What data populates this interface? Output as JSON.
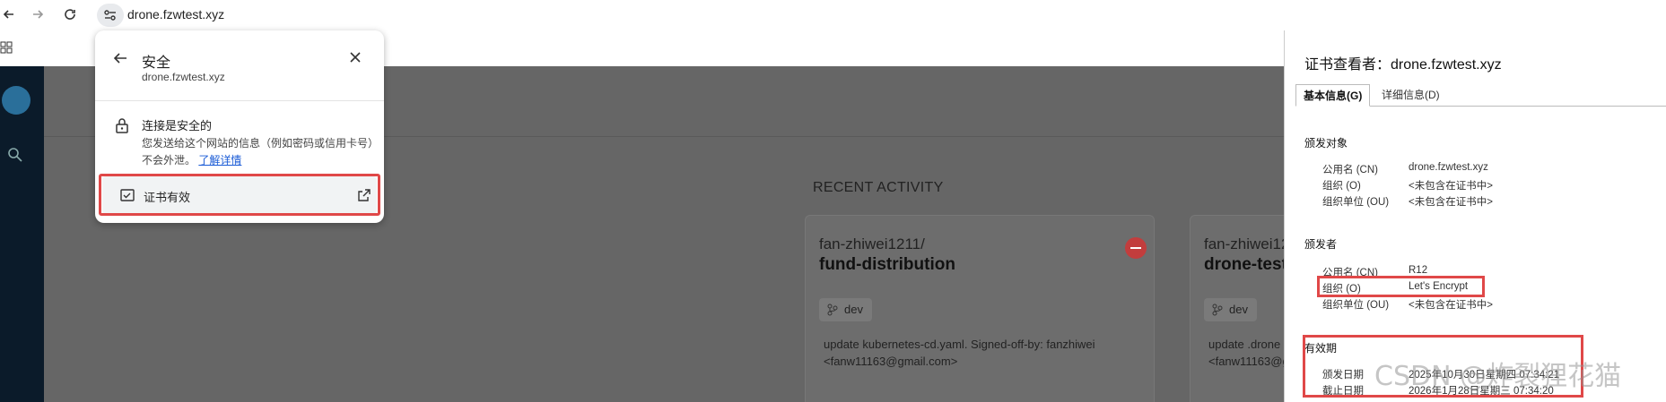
{
  "browser": {
    "url": "drone.fzwtest.xyz"
  },
  "security_popup": {
    "title": "安全",
    "domain": "drone.fzwtest.xyz",
    "connection_title": "连接是安全的",
    "connection_desc": "您发送给这个网站的信息（例如密码或信用卡号）不会外泄。",
    "learn_more": "了解详情",
    "cert_label": "证书有效"
  },
  "drone": {
    "recent_activity": "RECENT ACTIVITY",
    "cards": [
      {
        "owner": "fan-zhiwei1211/",
        "repo": "fund-distribution",
        "branch": "dev",
        "message": "update kubernetes-cd.yaml. Signed-off-by: fanzhiwei <fanw11163@gmail.com>"
      },
      {
        "owner": "fan-zhiwei12",
        "repo": "drone-test",
        "branch": "dev",
        "message": "update .drone <fanw11163@gm"
      }
    ]
  },
  "cert_viewer": {
    "title": "证书查看者：drone.fzwtest.xyz",
    "tabs": [
      "基本信息(G)",
      "详细信息(D)"
    ],
    "issued_to": {
      "heading": "颁发对象",
      "rows": [
        {
          "label": "公用名 (CN)",
          "value": "drone.fzwtest.xyz"
        },
        {
          "label": "组织 (O)",
          "value": "<未包含在证书中>"
        },
        {
          "label": "组织单位 (OU)",
          "value": "<未包含在证书中>"
        }
      ]
    },
    "issued_by": {
      "heading": "颁发者",
      "rows": [
        {
          "label": "公用名 (CN)",
          "value": "R12"
        },
        {
          "label": "组织 (O)",
          "value": "Let's Encrypt"
        },
        {
          "label": "组织单位 (OU)",
          "value": "<未包含在证书中>"
        }
      ]
    },
    "validity": {
      "heading": "有效期",
      "rows": [
        {
          "label": "颁发日期",
          "value": "2025年10月30日星期四 07:34:21"
        },
        {
          "label": "截止日期",
          "value": "2026年1月28日星期三 07:34:20"
        }
      ]
    }
  },
  "watermark": "CSDN @炸裂狸花猫",
  "colors": {
    "highlight": "#e04848",
    "link": "#1a5bd6",
    "nav_bg": "#0b1b2a",
    "overlay": "#6e6e6e"
  }
}
